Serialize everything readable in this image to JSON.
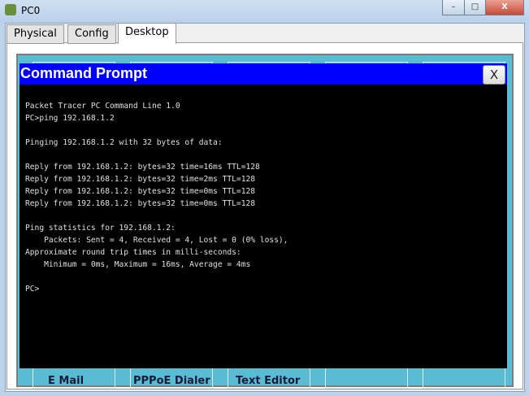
{
  "window": {
    "title": "PC0",
    "minimize": "–",
    "maximize": "□",
    "close": "X"
  },
  "tabs": [
    {
      "label": "Physical"
    },
    {
      "label": "Config"
    },
    {
      "label": "Desktop"
    }
  ],
  "desktop_apps": [
    {
      "label": "E Mail"
    },
    {
      "label": "PPPoE Dialer"
    },
    {
      "label": "Text Editor"
    }
  ],
  "command_prompt": {
    "title": "Command Prompt",
    "close": "X",
    "lines": [
      "Packet Tracer PC Command Line 1.0",
      "PC>ping 192.168.1.2",
      "",
      "Pinging 192.168.1.2 with 32 bytes of data:",
      "",
      "Reply from 192.168.1.2: bytes=32 time=16ms TTL=128",
      "Reply from 192.168.1.2: bytes=32 time=2ms TTL=128",
      "Reply from 192.168.1.2: bytes=32 time=0ms TTL=128",
      "Reply from 192.168.1.2: bytes=32 time=0ms TTL=128",
      "",
      "Ping statistics for 192.168.1.2:",
      "    Packets: Sent = 4, Received = 4, Lost = 0 (0% loss),",
      "Approximate round trip times in milli-seconds:",
      "    Minimum = 0ms, Maximum = 16ms, Average = 4ms",
      "",
      "PC>"
    ]
  }
}
